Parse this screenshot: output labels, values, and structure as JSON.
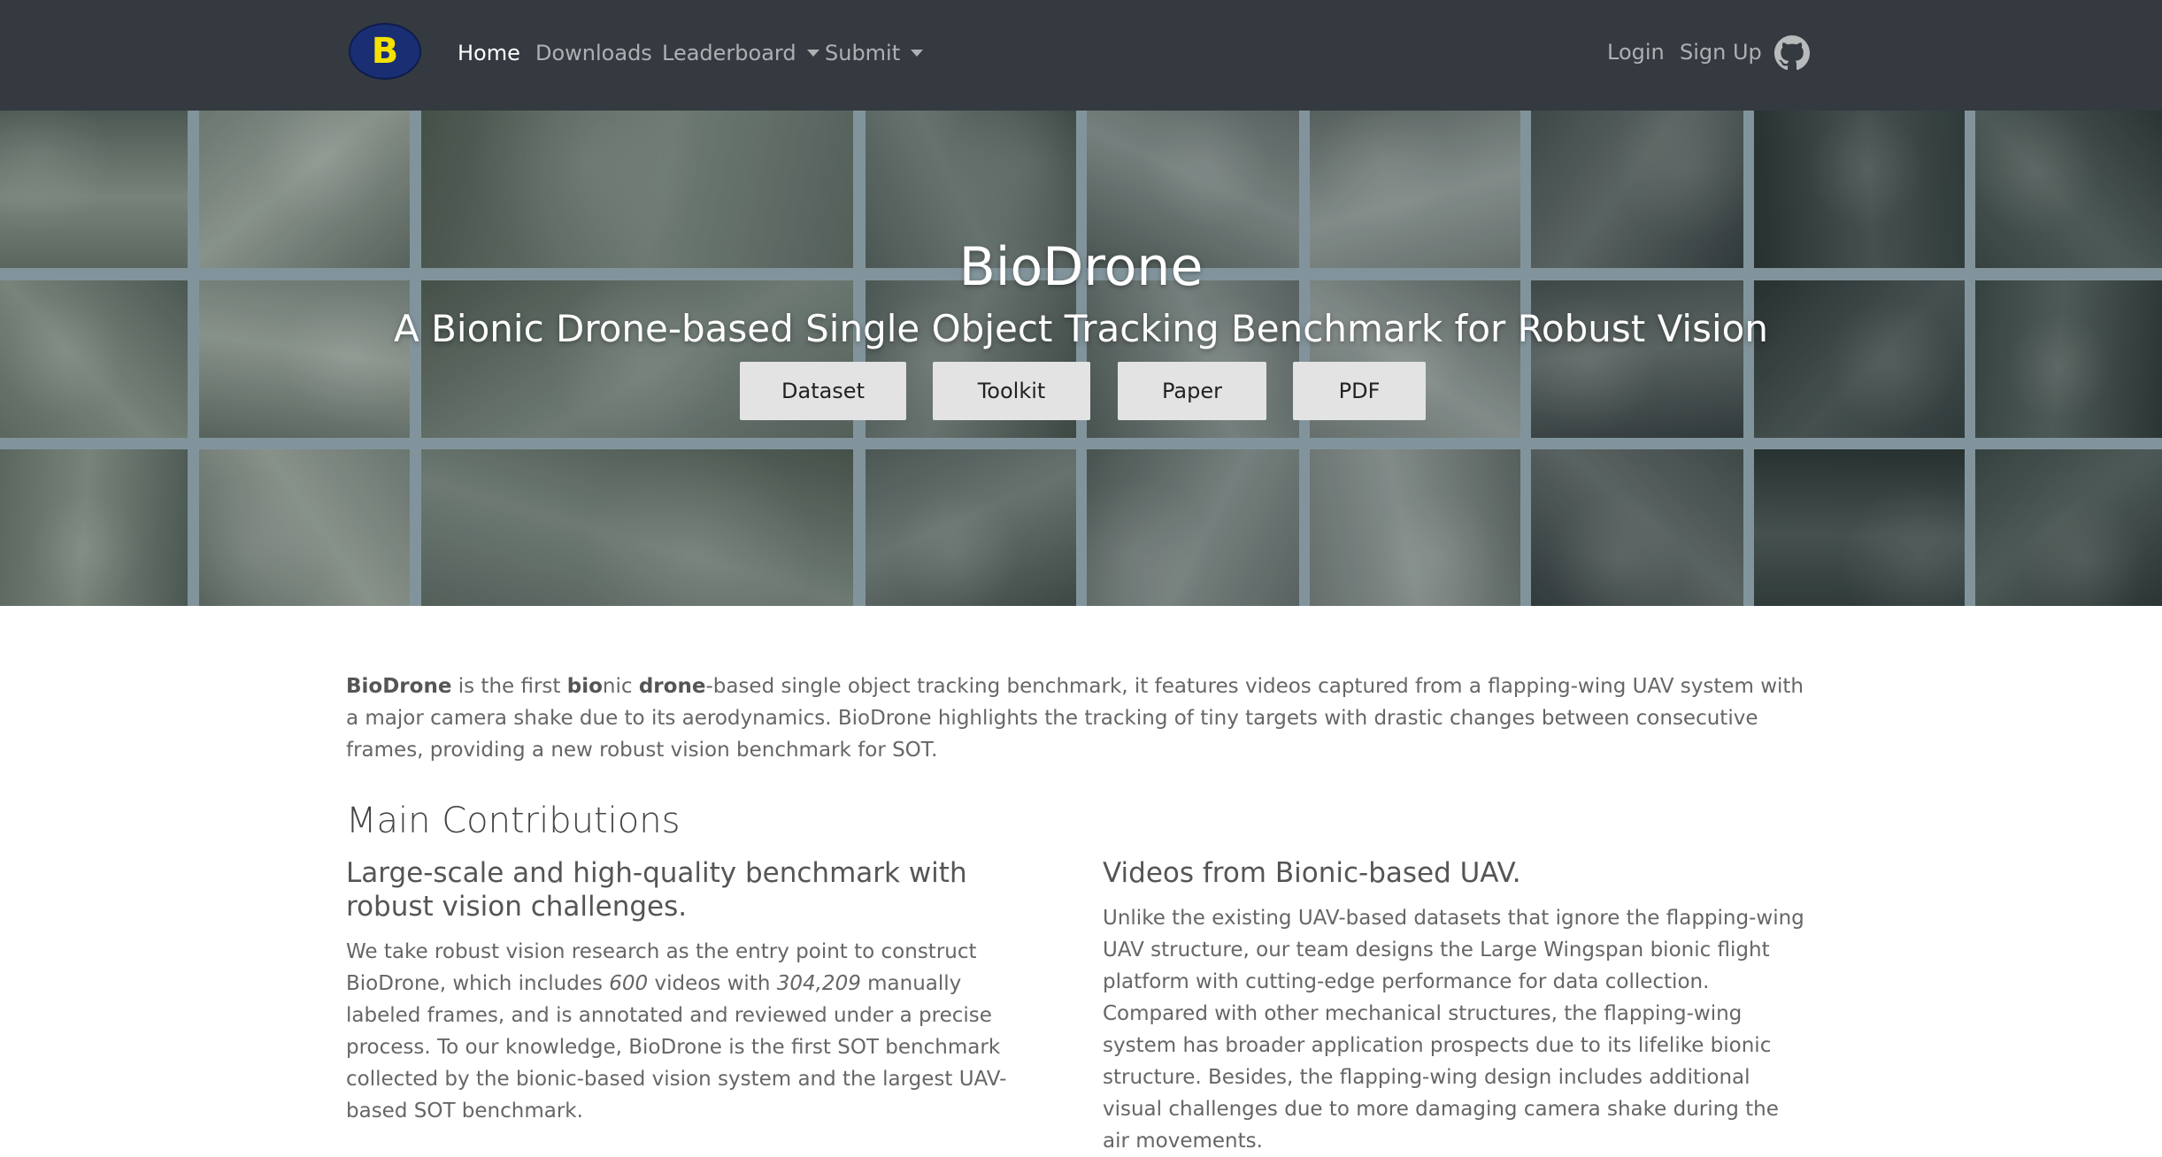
{
  "nav": {
    "logo_letter": "B",
    "items": [
      {
        "label": "Home"
      },
      {
        "label": "Downloads"
      },
      {
        "label": "Leaderboard"
      },
      {
        "label": "Submit"
      }
    ],
    "login": "Login",
    "signup": "Sign Up",
    "github_icon": "github-icon"
  },
  "hero": {
    "title": "BioDrone",
    "subtitle": "A Bionic Drone-based Single Object Tracking Benchmark for Robust Vision",
    "buttons": [
      "Dataset",
      "Toolkit",
      "Paper",
      "PDF"
    ]
  },
  "intro": {
    "b1": "BioDrone",
    "t1": " is the first ",
    "b2": "bio",
    "t2": "nic ",
    "b3": "drone",
    "t3": "-based single object tracking benchmark, it features videos captured from a flapping-wing UAV system with a major camera shake due to its aerodynamics. BioDrone highlights the tracking of tiny targets with drastic changes between consecutive frames, providing a new robust vision benchmark for SOT."
  },
  "main_heading": "Main Contributions",
  "left": {
    "heading": "Large-scale and high-quality benchmark with robust vision challenges.",
    "p1": "We take robust vision research as the entry point to construct BioDrone, which includes ",
    "n1": "600",
    "p2": " videos with ",
    "n2": "304,209",
    "p3": " manually labeled frames, and is annotated and reviewed under a precise process. To our knowledge, BioDrone is the first SOT benchmark collected by the bionic-based vision system and the largest UAV-based SOT benchmark."
  },
  "right": {
    "heading": "Videos from Bionic-based UAV.",
    "text": "Unlike the existing UAV-based datasets that ignore the flapping-wing UAV structure, our team designs the Large Wingspan bionic flight platform with cutting-edge performance for data collection. Compared with other mechanical structures, the flapping-wing system has broader application prospects due to its lifelike bionic structure. Besides, the flapping-wing design includes additional visual challenges due to more damaging camera shake during the air movements."
  },
  "colors": {
    "navbar": "#343a40",
    "logo_bg": "#1a2f73",
    "logo_fg": "#f5e100",
    "hero_grid": "#889ca2"
  }
}
